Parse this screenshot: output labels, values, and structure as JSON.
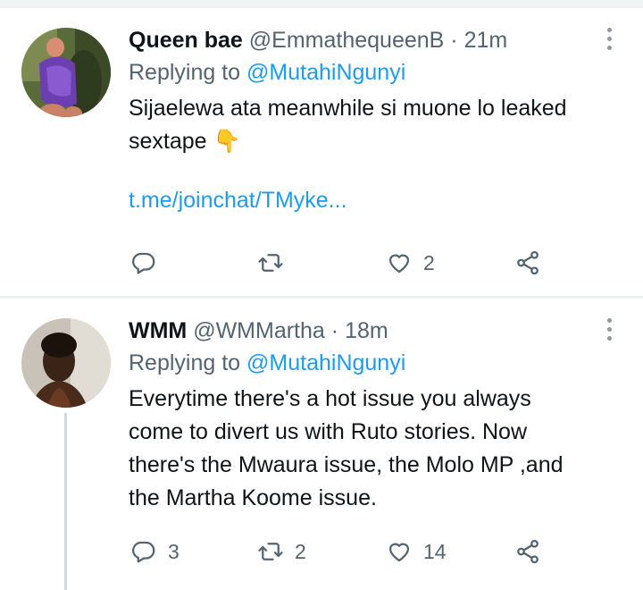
{
  "tweets": [
    {
      "display_name": "Queen bae",
      "handle": "@EmmathequeenB",
      "time": "· 21m",
      "replying_prefix": "Replying to",
      "replying_to": "@MutahiNgunyi",
      "text_line1": "Sijaelewa ata meanwhile si muone lo leaked",
      "text_line2": "sextape",
      "emoji": "👇",
      "link": "t.me/joinchat/TMyke...",
      "reply_count": "",
      "retweet_count": "",
      "like_count": "2",
      "avatar_icon": "profile-photo"
    },
    {
      "display_name": "WMM",
      "handle": "@WMMartha",
      "time": "· 18m",
      "replying_prefix": "Replying to",
      "replying_to": "@MutahiNgunyi",
      "text_lines": [
        "Everytime there's a hot issue you always",
        "come to divert us with Ruto stories. Now",
        "there's the Mwaura issue, the Molo MP ,and",
        "the Martha Koome issue."
      ],
      "reply_count": "3",
      "retweet_count": "2",
      "like_count": "14",
      "avatar_icon": "profile-photo"
    }
  ],
  "icons": {
    "reply": "reply-icon",
    "retweet": "retweet-icon",
    "like": "heart-icon",
    "share": "share-icon",
    "more": "more-vertical-icon"
  },
  "colors": {
    "accent": "#1d9bf0",
    "secondary_text": "#536471",
    "divider": "#eff3f4"
  }
}
